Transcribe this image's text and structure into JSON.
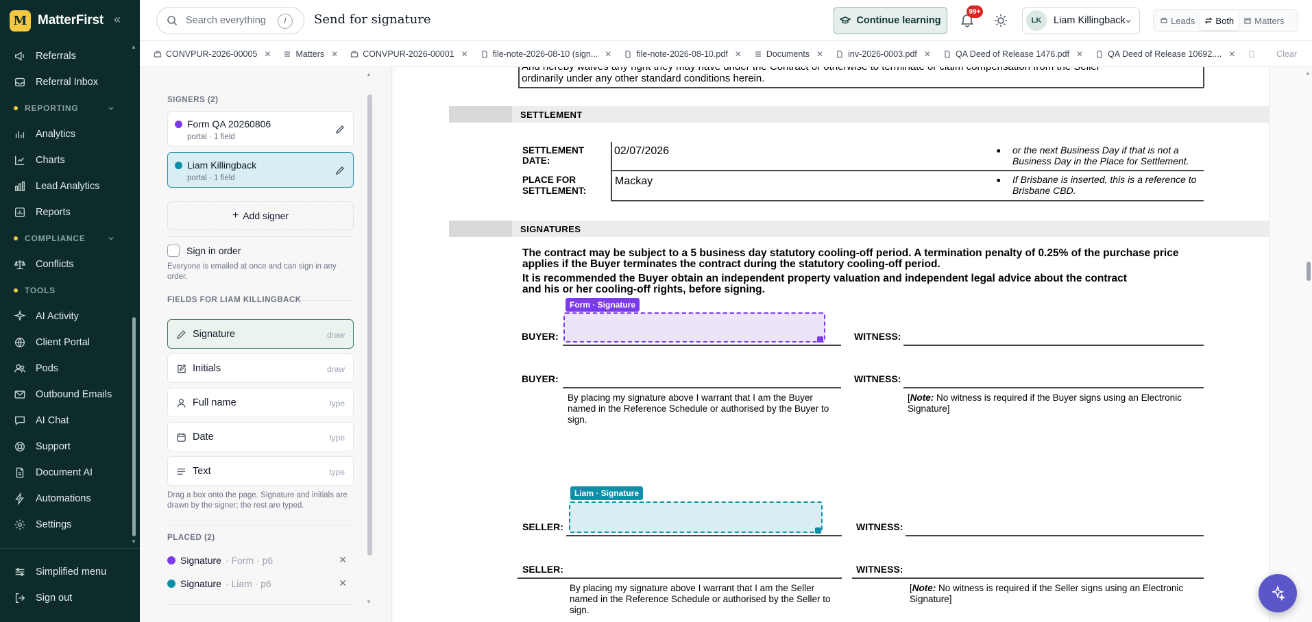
{
  "app": {
    "name": "MatterFirst",
    "logo_letter": "M"
  },
  "sidebar": {
    "top_items": [
      {
        "label": "Referrals",
        "icon": "megaphone-icon"
      },
      {
        "label": "Referral Inbox",
        "icon": "inbox-icon"
      }
    ],
    "sections": [
      {
        "title": "REPORTING",
        "items": [
          {
            "label": "Analytics",
            "icon": "chart-bars-icon"
          },
          {
            "label": "Charts",
            "icon": "chart-icon"
          },
          {
            "label": "Lead Analytics",
            "icon": "bar-chart-icon"
          },
          {
            "label": "Reports",
            "icon": "report-icon"
          }
        ]
      },
      {
        "title": "COMPLIANCE",
        "items": [
          {
            "label": "Conflicts",
            "icon": "scale-icon"
          }
        ]
      },
      {
        "title": "TOOLS",
        "items": [
          {
            "label": "AI Activity",
            "icon": "activity-icon"
          },
          {
            "label": "Client Portal",
            "icon": "globe-icon"
          },
          {
            "label": "Pods",
            "icon": "users-icon"
          },
          {
            "label": "Outbound Emails",
            "icon": "mail-icon"
          },
          {
            "label": "AI Chat",
            "icon": "chat-icon"
          },
          {
            "label": "Support",
            "icon": "lifebuoy-icon"
          },
          {
            "label": "Document AI",
            "icon": "document-ai-icon"
          },
          {
            "label": "Automations",
            "icon": "lightning-icon"
          },
          {
            "label": "Settings",
            "icon": "gear-icon"
          }
        ]
      }
    ],
    "bottom_items": [
      {
        "label": "Simplified menu",
        "icon": "sliders-icon"
      },
      {
        "label": "Sign out",
        "icon": "sign-out-icon"
      }
    ]
  },
  "header": {
    "search_placeholder": "Search everything",
    "search_shortcut": "/",
    "title": "Send for signature",
    "learn_label": "Continue learning",
    "notifications_badge": "99+",
    "user_initials": "LK",
    "user_name": "Liam Killingback",
    "segment": [
      "Leads",
      "Both",
      "Matters"
    ],
    "segment_active": "Both"
  },
  "tabs": {
    "items": [
      {
        "label": "CONVPUR-2026-00005",
        "icon": "matter-icon"
      },
      {
        "label": "Matters",
        "icon": "list-icon"
      },
      {
        "label": "CONVPUR-2026-00001",
        "icon": "matter-icon"
      },
      {
        "label": "file-note-2026-08-10 (sign...",
        "icon": "file-icon"
      },
      {
        "label": "file-note-2026-08-10.pdf",
        "icon": "file-icon"
      },
      {
        "label": "Documents",
        "icon": "list-icon"
      },
      {
        "label": "inv-2026-0003.pdf",
        "icon": "file-icon"
      },
      {
        "label": "QA Deed of Release 1476.pdf",
        "icon": "file-icon"
      },
      {
        "label": "QA Deed of Release 10692....",
        "icon": "file-icon"
      }
    ],
    "clear_label": "Clear"
  },
  "panel": {
    "signers_heading": "SIGNERS (2)",
    "signers": [
      {
        "name": "Form QA 20260806",
        "sub": "portal · 1 field",
        "color": "#7c3aed"
      },
      {
        "name": "Liam Killingback",
        "sub": "portal · 1 field",
        "color": "#0e8fa8"
      }
    ],
    "add_signer": "Add signer",
    "sign_in_order": "Sign in order",
    "sign_in_order_help": "Everyone is emailed at once and can sign in any order.",
    "fields_heading": "FIELDS FOR LIAM KILLINGBACK",
    "fields": [
      {
        "name": "Signature",
        "kind": "draw",
        "icon": "pen-icon"
      },
      {
        "name": "Initials",
        "kind": "draw",
        "icon": "edit-icon"
      },
      {
        "name": "Full name",
        "kind": "type",
        "icon": "person-icon"
      },
      {
        "name": "Date",
        "kind": "type",
        "icon": "calendar-icon"
      },
      {
        "name": "Text",
        "kind": "type",
        "icon": "text-lines-icon"
      }
    ],
    "fields_help": "Drag a box onto the page. Signature and initials are drawn by the signer; the rest are typed.",
    "placed_heading": "PLACED (2)",
    "placed": [
      {
        "name": "Signature",
        "meta": "· Form · p6",
        "color": "#7c3aed"
      },
      {
        "name": "Signature",
        "meta": "· Liam · p6",
        "color": "#0e8fa8"
      }
    ]
  },
  "document": {
    "top_text_1": "And hereby waives any right they may have under the Contract or otherwise to terminate or claim compensation from the Seller",
    "top_text_2": "ordinarily under any other standard conditions herein.",
    "settlement_title": "SETTLEMENT",
    "settlement_date_label_1": "SETTLEMENT",
    "settlement_date_label_2": "DATE:",
    "settlement_date": "02/07/2026",
    "settlement_date_note_1": "or the next Business Day if that is not a",
    "settlement_date_note_2": "Business Day in the Place for Settlement.",
    "place_label_1": "PLACE FOR",
    "place_label_2": "SETTLEMENT:",
    "place_value": "Mackay",
    "place_note_1": "If Brisbane is inserted, this is a reference to",
    "place_note_2": "Brisbane CBD.",
    "signatures_title": "SIGNATURES",
    "cooling_1": "The contract may be subject to a 5 business day statutory cooling-off period. A termination penalty of 0.25% of the purchase price",
    "cooling_2": "applies if the Buyer terminates the contract during the statutory cooling-off period.",
    "advice_1": "It is recommended the Buyer obtain an independent property valuation and independent legal advice about the contract",
    "advice_2": "and his or her cooling-off rights, before signing.",
    "buyer_label": "BUYER:",
    "seller_label": "SELLER:",
    "witness_label": "WITNESS:",
    "buyer_warrant_1": "By placing my signature above I warrant that I am the Buyer",
    "buyer_warrant_2": "named in the Reference Schedule or authorised by the Buyer to",
    "buyer_warrant_3": "sign.",
    "buyer_note_prefix": "[",
    "buyer_note_bold": "Note:",
    "buyer_note_1": " No witness is required if the Buyer signs using an Electronic",
    "buyer_note_2": "Signature]",
    "seller_warrant_1": "By placing my signature above I warrant that I am the Seller",
    "seller_warrant_2": "named in the Reference Schedule or authorised by the Seller to",
    "seller_warrant_3": "sign.",
    "seller_note_1": " No witness is required if the Seller signs using an Electronic",
    "seller_note_2": "Signature]",
    "tag_form": "Form · Signature",
    "tag_liam": "Liam · Signature"
  }
}
